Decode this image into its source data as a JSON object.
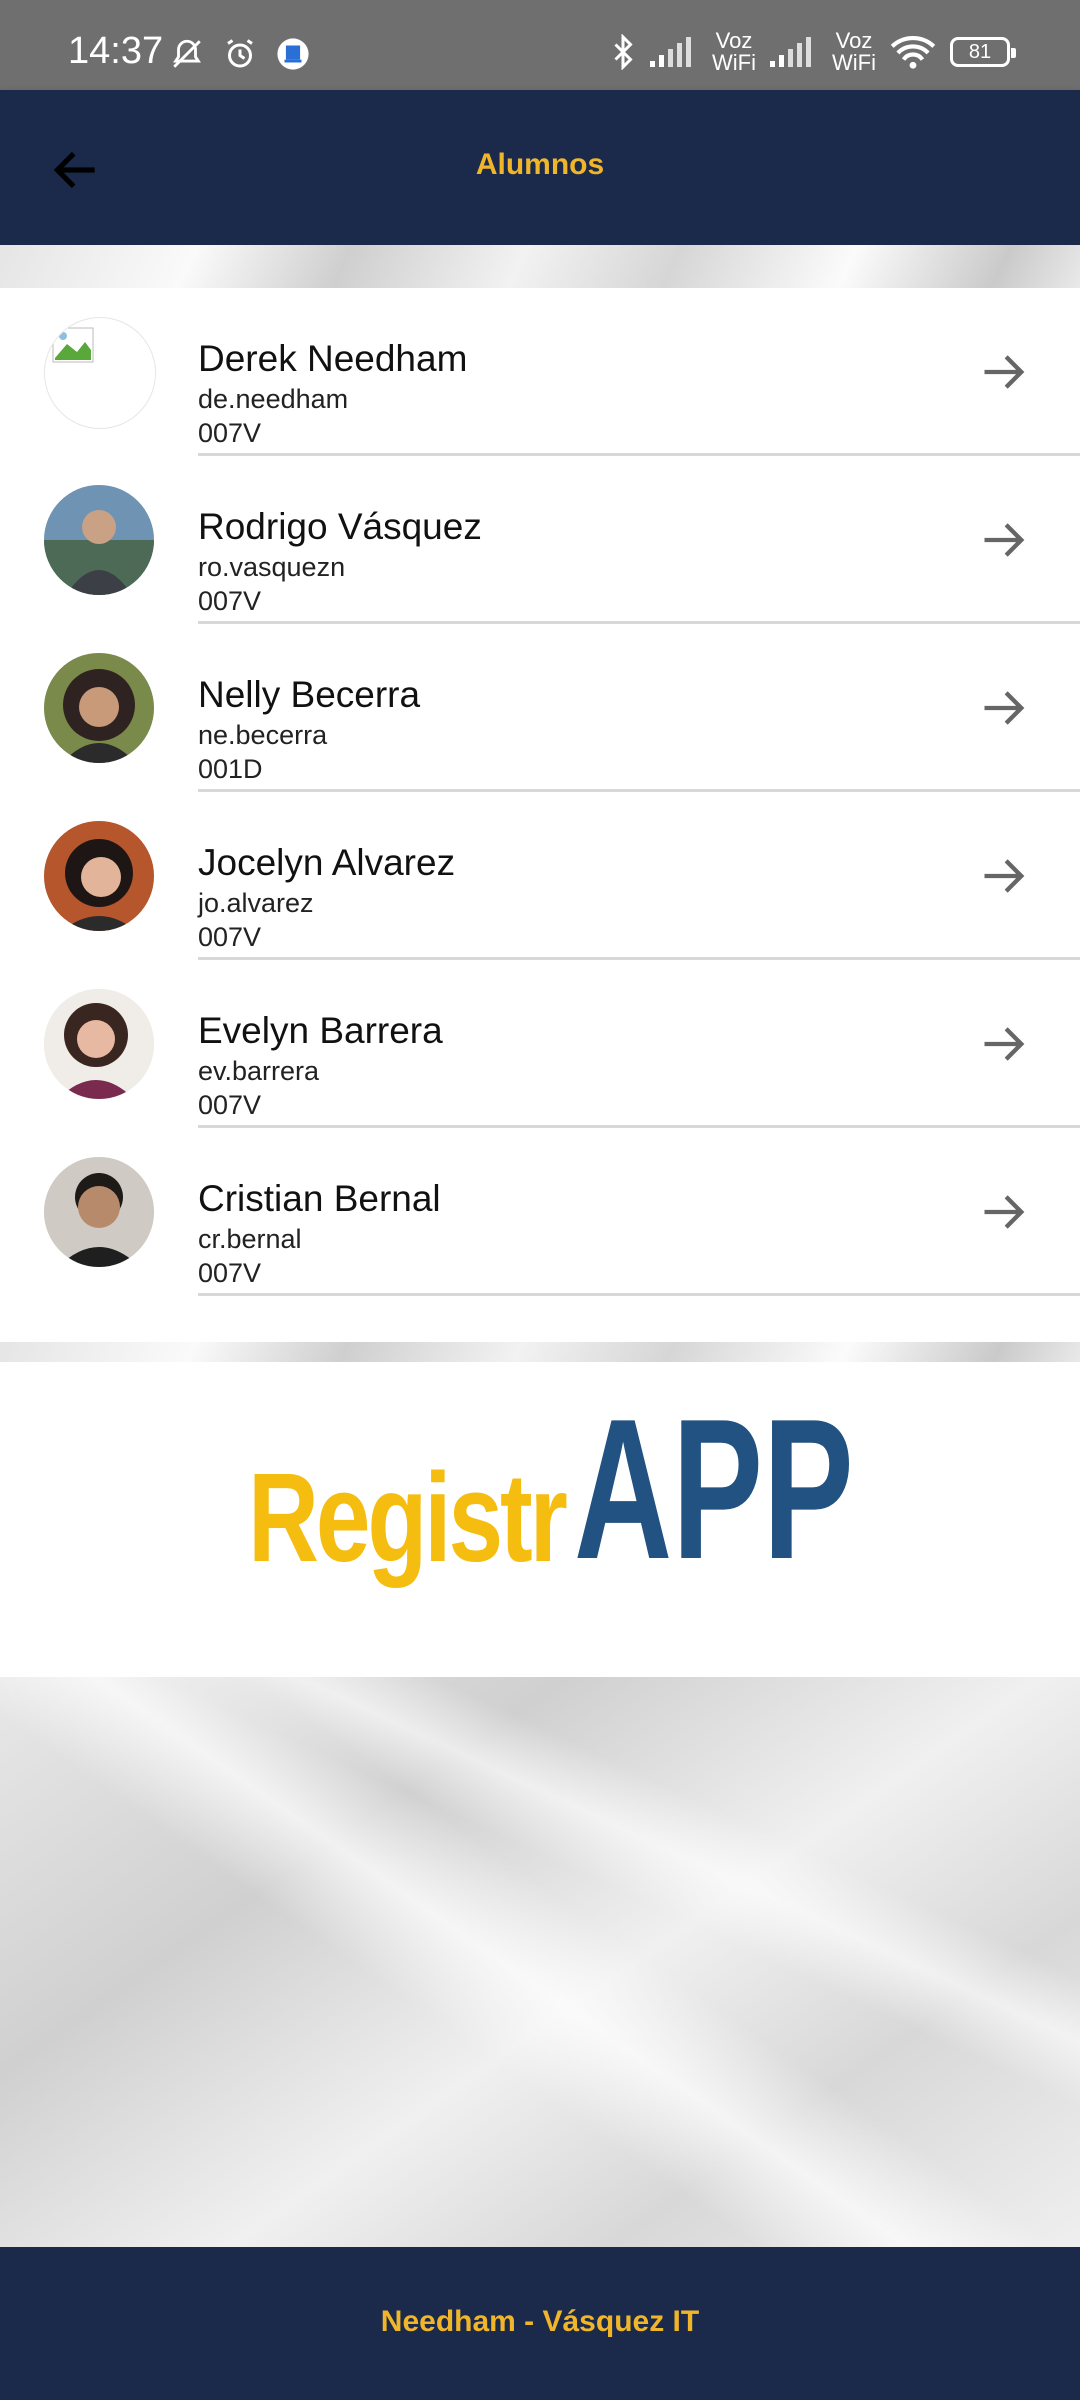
{
  "status_bar": {
    "time": "14:37",
    "voz_wifi_1": "Voz\nWiFi",
    "voz_wifi_2": "Voz\nWiFi",
    "battery": "81",
    "icons": [
      "mute-bell-icon",
      "alarm-icon",
      "app-notification-icon",
      "bluetooth-icon",
      "signal-icon",
      "signal-icon",
      "wifi-icon",
      "battery-icon"
    ]
  },
  "header": {
    "title": "Alumnos",
    "back_icon": "arrow-left-icon"
  },
  "students": [
    {
      "name": "Derek Needham",
      "username": "de.needham",
      "code": "007V",
      "avatar": "broken-image-icon"
    },
    {
      "name": "Rodrigo Vásquez",
      "username": "ro.vasquezn",
      "code": "007V",
      "avatar": "photo"
    },
    {
      "name": "Nelly Becerra",
      "username": "ne.becerra",
      "code": "001D",
      "avatar": "photo"
    },
    {
      "name": "Jocelyn Alvarez",
      "username": "jo.alvarez",
      "code": "007V",
      "avatar": "photo"
    },
    {
      "name": "Evelyn Barrera",
      "username": "ev.barrera",
      "code": "007V",
      "avatar": "photo"
    },
    {
      "name": "Cristian Bernal",
      "username": "cr.bernal",
      "code": "007V",
      "avatar": "photo"
    }
  ],
  "logo": {
    "part1": "Registr",
    "part2": "APP",
    "color1": "#f5bd0f",
    "color2": "#215281"
  },
  "footer": {
    "text": "Needham - Vásquez IT"
  },
  "colors": {
    "header_bg": "#1b2a4a",
    "accent": "#f1b52a"
  }
}
